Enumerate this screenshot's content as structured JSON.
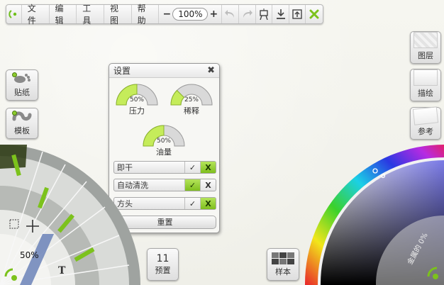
{
  "toolbar": {
    "menus": [
      "文件",
      "编辑",
      "工具",
      "视图",
      "帮助"
    ],
    "zoom_minus": "−",
    "zoom_value": "100%",
    "zoom_plus": "+"
  },
  "left_tools": {
    "stickers_label": "贴纸",
    "templates_label": "模板"
  },
  "right_tools": {
    "layers_label": "图层",
    "tracing_label": "描绘",
    "reference_label": "参考"
  },
  "settings": {
    "title": "设置",
    "close": "✖",
    "pressure": {
      "label": "压力",
      "value": 50,
      "display": "50%"
    },
    "thinning": {
      "label": "稀释",
      "value": 25,
      "display": "25%"
    },
    "paint_amount": {
      "label": "油量",
      "value": 50,
      "display": "50%"
    },
    "toggles": [
      {
        "label": "即干",
        "check": "✓",
        "cross": "X",
        "state": "off"
      },
      {
        "label": "自动清洗",
        "check": "✓",
        "cross": "X",
        "state": "on"
      },
      {
        "label": "方头",
        "check": "✓",
        "cross": "X",
        "state": "off"
      }
    ],
    "reset_label": "重置"
  },
  "presets": {
    "count": "11",
    "label": "预置"
  },
  "samples": {
    "label": "样本"
  },
  "brush_wheel": {
    "size_display": "50%"
  },
  "color_wheel": {
    "metallic_label": "金属的 0%"
  },
  "colors": {
    "accent_green": "#8ccc2c",
    "panel_bg": "#f7f7f4",
    "canvas": "#f4f4ee"
  }
}
